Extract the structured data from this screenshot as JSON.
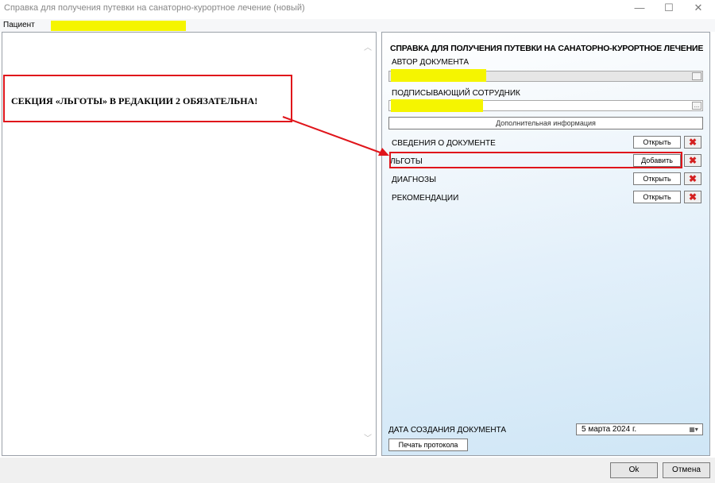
{
  "window": {
    "title": "Справка для получения путевки на санаторно-курортное лечение (новый)",
    "minimize": "—",
    "maximize": "☐",
    "close": "✕"
  },
  "patient": {
    "label": "Пациент"
  },
  "annotation": {
    "text": "СЕКЦИЯ «ЛЬГОТЫ» В РЕДАКЦИИ 2 ОБЯЗАТЕЛЬНА!"
  },
  "form": {
    "title": "СПРАВКА ДЛЯ ПОЛУЧЕНИЯ ПУТЕВКИ НА САНАТОРНО-КУРОРТНОЕ ЛЕЧЕНИЕ",
    "author_label": "АВТОР ДОКУМЕНТА",
    "signer_label": "ПОДПИСЫВАЮЩИЙ СОТРУДНИК",
    "picker_glyph": "...",
    "extra_info_button": "Дополнительная информация",
    "sections": [
      {
        "label": "СВЕДЕНИЯ О ДОКУМЕНТЕ",
        "button": "Открыть"
      },
      {
        "label": "ЛЬГОТЫ",
        "button": "Добавить"
      },
      {
        "label": "ДИАГНОЗЫ",
        "button": "Открыть"
      },
      {
        "label": "РЕКОМЕНДАЦИИ",
        "button": "Открыть"
      }
    ],
    "delete_glyph": "✖",
    "date_label": "ДАТА СОЗДАНИЯ ДОКУМЕНТА",
    "date_value": "5   марта   2024 г.",
    "calendar_glyph": "▦▾",
    "print_button": "Печать протокола"
  },
  "footer": {
    "ok": "Ok",
    "cancel": "Отмена"
  },
  "colors": {
    "annotation_red": "#e0151b",
    "highlight_yellow": "#f5f500"
  }
}
